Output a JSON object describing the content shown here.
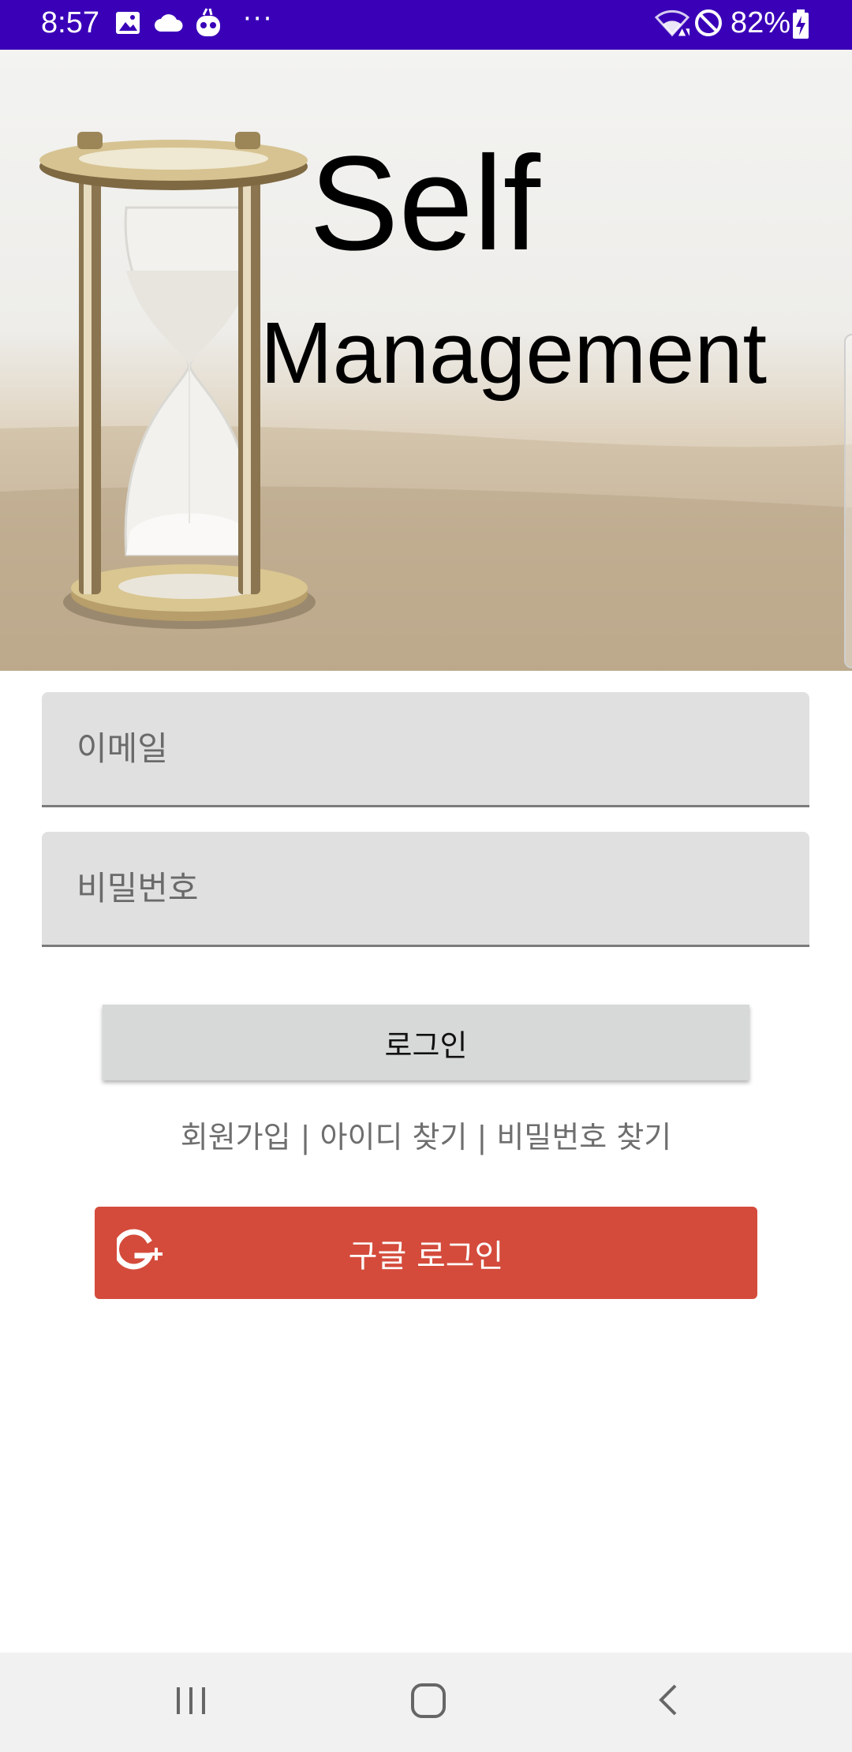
{
  "status_bar": {
    "time": "8:57",
    "battery": "82%",
    "more": "···",
    "icons": [
      "gallery-icon",
      "cloud-icon",
      "app-mascot-icon",
      "wifi-icon",
      "do-not-disturb-icon",
      "battery-charging-icon"
    ],
    "color": "#3a00b8"
  },
  "hero": {
    "title_line1": "Self",
    "title_line2": "Management"
  },
  "form": {
    "email_placeholder": "이메일",
    "password_placeholder": "비밀번호",
    "login_label": "로그인"
  },
  "links": {
    "signup": "회원가입",
    "separator": " | ",
    "find_id": "아이디 찾기",
    "find_password": "비밀번호 찾기"
  },
  "google": {
    "label": "구글 로그인",
    "icon": "google-plus-icon",
    "color": "#d44b3b"
  },
  "nav": {
    "icons": [
      "recent-apps-icon",
      "home-icon",
      "back-icon"
    ]
  }
}
